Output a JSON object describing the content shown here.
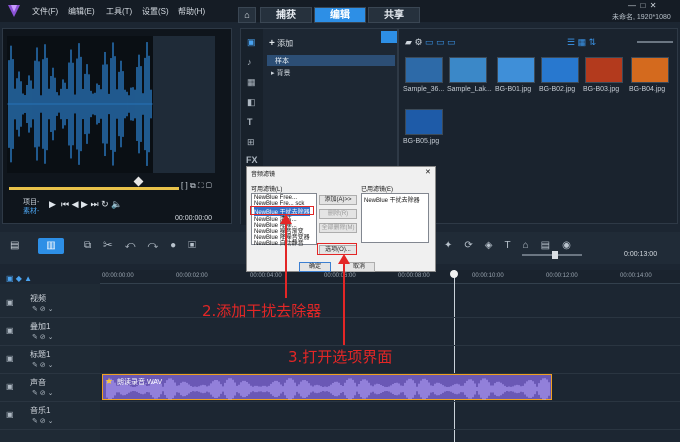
{
  "app": {
    "logo_alt": "Corel VideoStudio",
    "project_info": "未命名, 1920*1080"
  },
  "menus": [
    "文件(F)",
    "编辑(E)",
    "工具(T)",
    "设置(S)",
    "帮助(H)"
  ],
  "tabs": [
    "捕获",
    "编辑",
    "共享"
  ],
  "active_tab": "编辑",
  "player": {
    "project_label": "项目-",
    "clip_label": "素材-",
    "timecode": "00:00:00:00"
  },
  "library": {
    "add_label": "添加",
    "items": [
      "样本",
      "背景"
    ]
  },
  "thumbnails": [
    {
      "label": "Sample_36...",
      "color": "#2d6aa8"
    },
    {
      "label": "Sample_Lak...",
      "color": "#3b88c8"
    },
    {
      "label": "BG-B01.jpg",
      "color": "#3f8fd8"
    },
    {
      "label": "BG-B02.jpg",
      "color": "#2878cf"
    },
    {
      "label": "BG-B03.jpg",
      "color": "#b33a1d"
    },
    {
      "label": "BG-B04.jpg",
      "color": "#d46a1e"
    },
    {
      "label": "BG-B05.jpg",
      "color": "#1e5ba8"
    }
  ],
  "timeline": {
    "ruler": [
      "00:00:00:00",
      "00:00:02:00",
      "00:00:04:00",
      "00:00:06:00",
      "00:00:08:00",
      "00:00:10:00",
      "00:00:12:00",
      "00:00:14:00"
    ],
    "timecode": "0:00:13:00",
    "tracks": [
      "视频",
      "叠加1",
      "标题1",
      "声音",
      "音乐1"
    ],
    "clip_label": "朗读录音.WAV"
  },
  "dialog": {
    "title": "音频滤镜",
    "available_label": "可用滤镜(L)",
    "applied_label": "已用滤镜(E)",
    "available_items": [
      "NewBlue Free...",
      "NewBlue Fre... sck",
      "NewBlue 干扰去除器",
      "NewBlue 清洁...",
      "NewBlue 降噪...",
      "NewBlue 噪音渐变",
      "NewBlue 降噪音变器",
      "NewBlue 自动静音"
    ],
    "applied_items": [
      "NewBlue 干扰去除器"
    ],
    "add_btn": "添加(A)>>",
    "remove_btn": "删除(R)",
    "remove_all_btn": "全部删除(M)",
    "options_btn": "选项(O)...",
    "ok_btn": "确定",
    "cancel_btn": "取消"
  },
  "annotations": {
    "step2": "2.添加干扰去除器",
    "step3": "3.打开选项界面"
  },
  "colors": {
    "accent": "#2d8fe6",
    "annotation": "#e32626",
    "clip": "#6a58b5"
  }
}
